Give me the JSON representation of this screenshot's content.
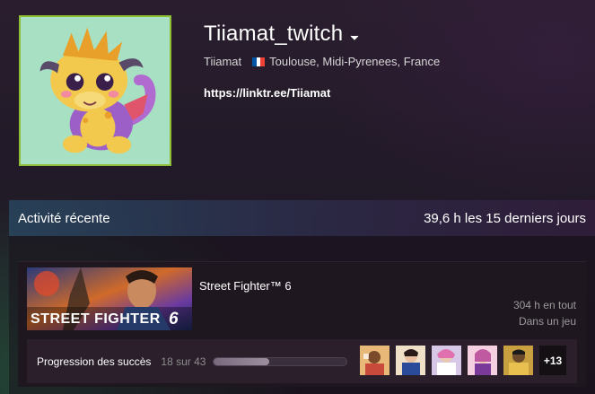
{
  "profile": {
    "persona_name": "Tiiamat_twitch",
    "real_name": "Tiiamat",
    "location": "Toulouse, Midi-Pyrenees, France",
    "flag_colors": [
      "#0055a4",
      "#ffffff",
      "#ef4135"
    ],
    "link": "https://linktr.ee/Tiiamat",
    "avatar_icon": "dragon-avatar",
    "avatar_border_color": "#8fbe34"
  },
  "recent_activity": {
    "title": "Activité récente",
    "hours_summary": "39,6 h les 15 derniers jours"
  },
  "game": {
    "name": "Street Fighter™ 6",
    "capsule_text": "STREET FIGHTER",
    "capsule_number": "6",
    "hours_total": "304 h en tout",
    "last_played": "Dans un jeu",
    "achievements": {
      "label": "Progression des succès",
      "count_text": "18 sur 43",
      "unlocked": 18,
      "total": 43,
      "icons": [
        "achievement-icon-1",
        "achievement-icon-2",
        "achievement-icon-3",
        "achievement-icon-4",
        "achievement-icon-5"
      ],
      "more_label": "+13"
    }
  }
}
